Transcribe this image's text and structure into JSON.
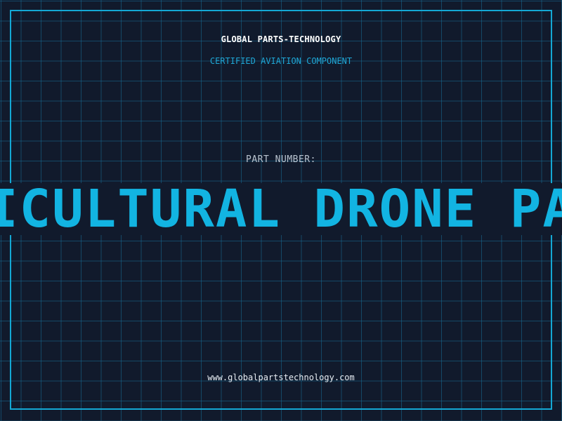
{
  "header": {
    "company": "GLOBAL PARTS-TECHNOLOGY",
    "subtitle": "CERTIFIED AVIATION COMPONENT"
  },
  "part": {
    "label": "PART NUMBER:",
    "value": "AGRICULTURAL DRONE PARTS"
  },
  "footer": {
    "website": "www.globalpartstechnology.com"
  },
  "colors": {
    "background": "#111a2c",
    "accent": "#12b4e2",
    "grid": "#176e96"
  }
}
